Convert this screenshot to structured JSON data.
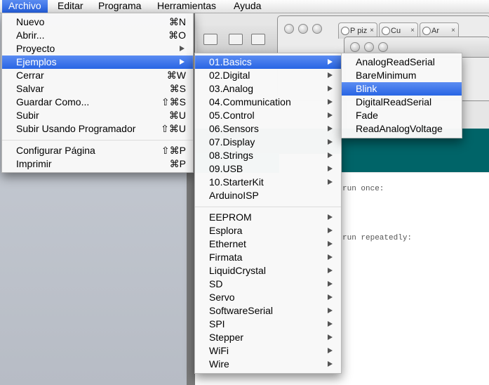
{
  "menubar": {
    "items": [
      "Archivo",
      "Editar",
      "Programa",
      "Herramientas",
      "Ayuda"
    ]
  },
  "archivo_menu": {
    "group1": [
      {
        "label": "Nuevo",
        "shortcut": "⌘N"
      },
      {
        "label": "Abrir...",
        "shortcut": "⌘O"
      },
      {
        "label": "Proyecto",
        "submenu": true
      },
      {
        "label": "Ejemplos",
        "submenu": true,
        "highlighted": true
      },
      {
        "label": "Cerrar",
        "shortcut": "⌘W"
      },
      {
        "label": "Salvar",
        "shortcut": "⌘S"
      },
      {
        "label": "Guardar Como...",
        "shortcut": "⇧⌘S"
      },
      {
        "label": "Subir",
        "shortcut": "⌘U"
      },
      {
        "label": "Subir Usando Programador",
        "shortcut": "⇧⌘U"
      }
    ],
    "group2": [
      {
        "label": "Configurar Página",
        "shortcut": "⇧⌘P"
      },
      {
        "label": "Imprimir",
        "shortcut": "⌘P"
      }
    ]
  },
  "ejemplos_menu": {
    "group1": [
      {
        "label": "01.Basics",
        "submenu": true,
        "highlighted": true
      },
      {
        "label": "02.Digital",
        "submenu": true
      },
      {
        "label": "03.Analog",
        "submenu": true
      },
      {
        "label": "04.Communication",
        "submenu": true
      },
      {
        "label": "05.Control",
        "submenu": true
      },
      {
        "label": "06.Sensors",
        "submenu": true
      },
      {
        "label": "07.Display",
        "submenu": true
      },
      {
        "label": "08.Strings",
        "submenu": true
      },
      {
        "label": "09.USB",
        "submenu": true
      },
      {
        "label": "10.StarterKit",
        "submenu": true
      },
      {
        "label": "ArduinoISP",
        "submenu": false
      }
    ],
    "group2": [
      {
        "label": "EEPROM",
        "submenu": true
      },
      {
        "label": "Esplora",
        "submenu": true
      },
      {
        "label": "Ethernet",
        "submenu": true
      },
      {
        "label": "Firmata",
        "submenu": true
      },
      {
        "label": "LiquidCrystal",
        "submenu": true
      },
      {
        "label": "SD",
        "submenu": true
      },
      {
        "label": "Servo",
        "submenu": true
      },
      {
        "label": "SoftwareSerial",
        "submenu": true
      },
      {
        "label": "SPI",
        "submenu": true
      },
      {
        "label": "Stepper",
        "submenu": true
      },
      {
        "label": "WiFi",
        "submenu": true
      },
      {
        "label": "Wire",
        "submenu": true
      }
    ]
  },
  "basics_menu": {
    "items": [
      {
        "label": "AnalogReadSerial"
      },
      {
        "label": "BareMinimum"
      },
      {
        "label": "Blink",
        "highlighted": true
      },
      {
        "label": "DigitalReadSerial"
      },
      {
        "label": "Fade"
      },
      {
        "label": "ReadAnalogVoltage"
      }
    ]
  },
  "browser": {
    "tabs": [
      "P piz",
      "Cu",
      "Ar"
    ]
  },
  "editor": {
    "line1": "run once:",
    "line2": "run repeatedly:"
  },
  "colors": {
    "highlight": "#2865e4",
    "ide_teal": "#006468",
    "ide_teal_tab": "#00979c"
  }
}
